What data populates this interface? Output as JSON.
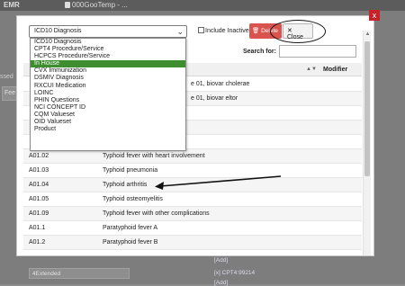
{
  "app": {
    "title": "EMR",
    "tab_title": "000GooTemp - ..."
  },
  "background": {
    "left_text": "ssed",
    "left_field": "Fee S",
    "rows": [
      {
        "value": "",
        "link": "[Add]"
      },
      {
        "value": "4Extended",
        "link": "[x] CPT4:99214"
      },
      {
        "value": "",
        "link": "[Add]"
      }
    ]
  },
  "modal": {
    "close_x": "x",
    "code_type_select": {
      "value": "ICD10 Diagnosis",
      "options": [
        "ICD10 Diagnosis",
        "CPT4 Procedure/Service",
        "HCPCS Procedure/Service",
        "In House",
        "CVX Immunization",
        "DSMIV Diagnosis",
        "RXCUI Medication",
        "LOINC",
        "PHIN Questions",
        "NCI CONCEPT ID",
        "CQM Valueset",
        "OID Valueset",
        "Product"
      ],
      "highlighted": "In House"
    },
    "include_inactive_label": "Include Inactive",
    "delete_label": "Delete",
    "close_label": "Close",
    "search_label": "Search for:",
    "search_value": "",
    "columns": {
      "modifier": "Modifier"
    },
    "partial_rows": [
      "e 01, biovar cholerae",
      "e 01, biovar eltor"
    ],
    "rows": [
      {
        "code": "A01.02",
        "description": "Typhoid fever with heart involvement"
      },
      {
        "code": "A01.03",
        "description": "Typhoid pneumonia"
      },
      {
        "code": "A01.04",
        "description": "Typhoid arthritis"
      },
      {
        "code": "A01.05",
        "description": "Typhoid osteomyelitis"
      },
      {
        "code": "A01.09",
        "description": "Typhoid fever with other complications"
      },
      {
        "code": "A01.1",
        "description": "Paratyphoid fever A"
      },
      {
        "code": "A01.2",
        "description": "Paratyphoid fever B"
      }
    ]
  },
  "colors": {
    "delete_red": "#d9534f",
    "close_x_red": "#c82129",
    "highlight_green": "#3e8e2f"
  }
}
